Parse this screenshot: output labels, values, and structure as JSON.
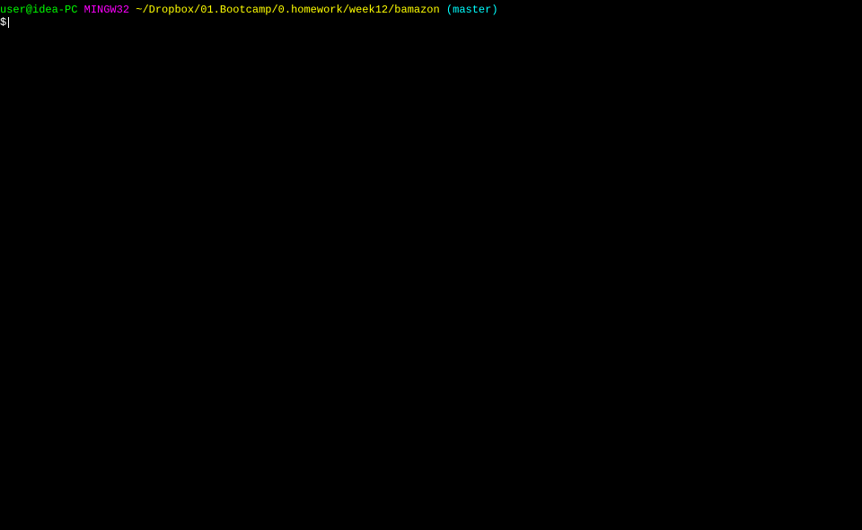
{
  "prompt": {
    "user_host": "user@idea-PC",
    "system": "MINGW32",
    "path": "~/Dropbox/01.Bootcamp/0.homework/week12/bamazon",
    "branch_open": "(",
    "branch": "master",
    "branch_close": ")",
    "prompt_char": "$",
    "command": ""
  }
}
